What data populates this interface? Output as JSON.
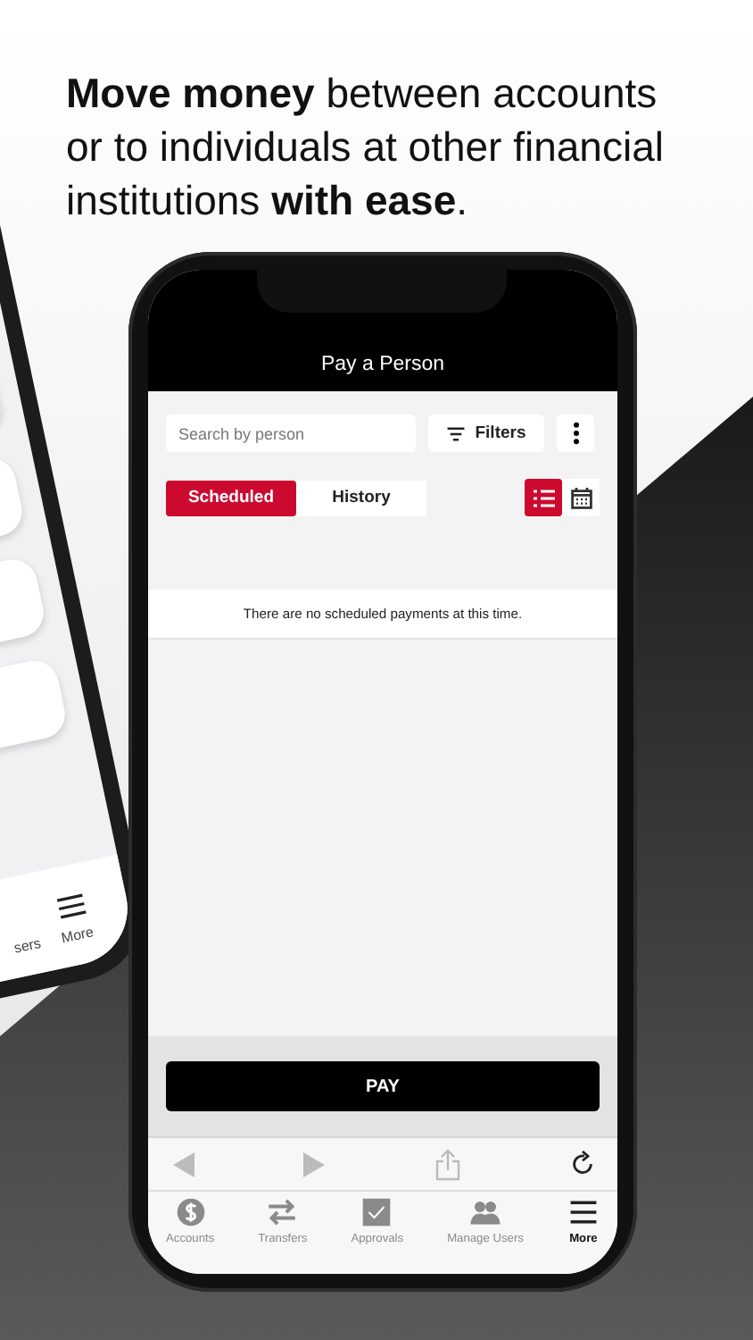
{
  "headline": "**Move money** between accounts or to individuals at other financial institutions **with ease**.",
  "back_phone": {
    "tabs": [
      {
        "label": "sers",
        "kind": "users"
      },
      {
        "label": "More",
        "kind": "more"
      }
    ]
  },
  "screen": {
    "title": "Pay a Person",
    "search": {
      "placeholder": "Search by person"
    },
    "filters_label": "Filters",
    "segments": [
      {
        "label": "Scheduled",
        "selected": true
      },
      {
        "label": "History",
        "selected": false
      }
    ],
    "views": [
      {
        "kind": "list",
        "selected": true
      },
      {
        "kind": "calendar",
        "selected": false
      }
    ],
    "empty_message": "There are no scheduled payments at this time.",
    "pay_label": "PAY",
    "browser": [
      {
        "kind": "back",
        "disabled": true
      },
      {
        "kind": "forward",
        "disabled": true
      },
      {
        "kind": "share",
        "disabled": true
      },
      {
        "kind": "reload",
        "disabled": false
      }
    ],
    "tabs": [
      {
        "label": "Accounts",
        "kind": "dollar",
        "selected": false
      },
      {
        "label": "Transfers",
        "kind": "transfer",
        "selected": false
      },
      {
        "label": "Approvals",
        "kind": "check",
        "selected": false
      },
      {
        "label": "Manage Users",
        "kind": "users",
        "selected": false
      },
      {
        "label": "More",
        "kind": "more",
        "selected": true
      }
    ]
  }
}
